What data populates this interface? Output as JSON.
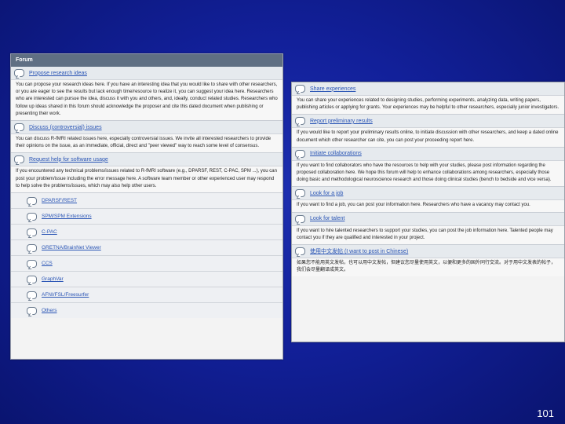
{
  "left_panel": {
    "header": "Forum",
    "categories": [
      {
        "title": "Propose research ideas",
        "description": "You can propose your research ideas here. If you have an interesting idea that you would like to share with other researchers, or you are eager to see the results but lack enough time/resource to realize it, you can suggest your idea here. Researchers who are interested can pursue the idea, discuss it with you and others, and, ideally, conduct related studies. Researchers who follow up ideas shared in this forum should acknowledge the proposer and cite this dated document when publishing or presenting their work."
      },
      {
        "title": "Discuss (controversial) issues",
        "description": "You can discuss R-fMRI related issues here, especially controversial issues. We invite all interested researchers to provide their opinions on the issue, as an immediate, official, direct and \"peer viewed\" way to reach some level of consensus."
      },
      {
        "title": "Request help for software usage",
        "description": "If you encountered any technical problems/issues related to R-fMRI software (e.g., DPARSF, REST, C-PAC, SPM ...), you can post your problem/issue including the error message here. A software team member or other experienced user may respond to help solve the problems/issues, which may also help other users."
      }
    ],
    "subforums": [
      "DPARSF/REST",
      "SPM/SPM Extensions",
      "C-PAC",
      "GRETNA/BrainNet Viewer",
      "CCS",
      "GraphVar",
      "AFNI/FSL/Freesurfer",
      "Others"
    ]
  },
  "right_panel": {
    "categories": [
      {
        "title": "Share experiences",
        "description": "You can share your experiences related to designing studies, performing experiments, analyzing data, writing papers, publishing articles or applying for grants. Your experiences may be helpful to other researchers, especially junior investigators."
      },
      {
        "title": "Report preliminary results",
        "description": "If you would like to report your preliminary results online, to initiate discussion with other researchers, and keep a dated online document which other researcher can cite, you can post your proceeding report here."
      },
      {
        "title": "Initiate collaborations",
        "description": "If you want to find collaborators who have the resources to help with your studies, please post information regarding the proposed collaboration here. We hope this forum will help to enhance collaborations among researchers, especially those doing basic and methodological neuroscience research and those doing clinical studies (bench to bedside and vice versa)."
      },
      {
        "title": "Look for a job",
        "description": "If you want to find a job, you can post your information here. Researchers who have a vacancy may contact you."
      },
      {
        "title": "Look for talent",
        "description": "If you want to hire talented researchers to support your studies, you can post the job information here. Talented people may contact you if they are qualified and interested in your project."
      },
      {
        "title": "使用中文发帖 (I want to post in Chinese)",
        "description": "如果您不能用英文发帖，也可以用中文发帖，但建议您尽量使用英文，以便和更多的国外同行交流。对于用中文发表的帖子，我们会尽量翻译成英文。"
      }
    ]
  },
  "page_number": "101"
}
